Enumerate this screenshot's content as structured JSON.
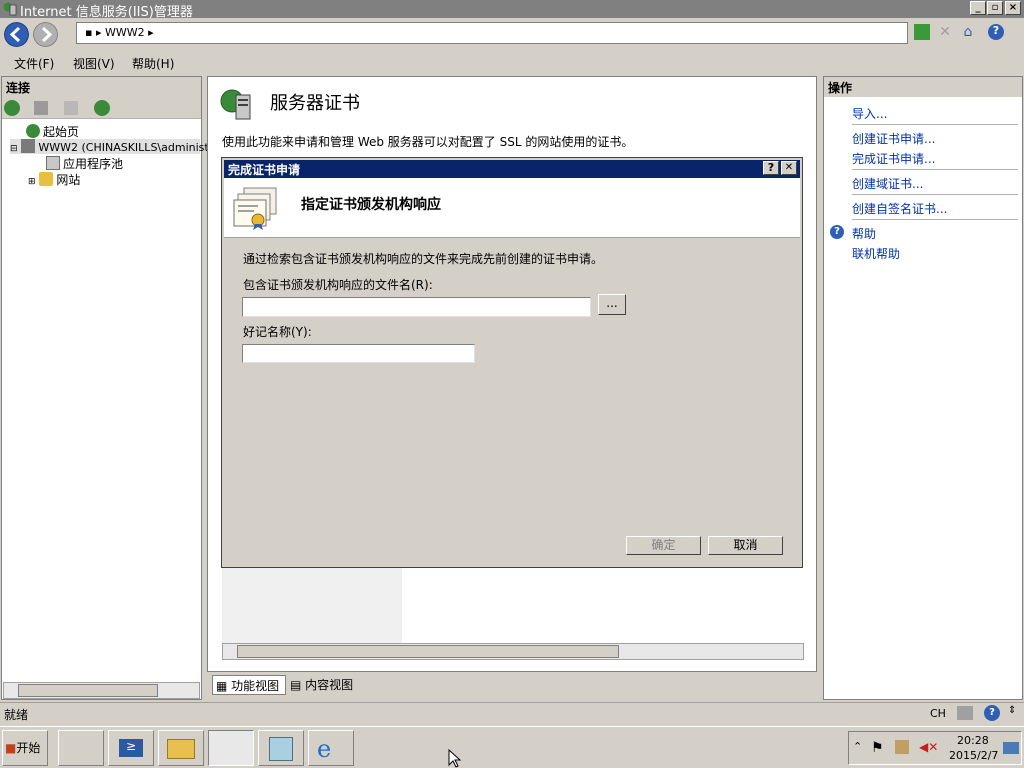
{
  "window": {
    "title": "Internet 信息服务(IIS)管理器",
    "address_path": "WWW2"
  },
  "menu": [
    "文件(F)",
    "视图(V)",
    "帮助(H)"
  ],
  "left_panel": {
    "header": "连接",
    "tree": [
      "起始页",
      "WWW2 (CHINASKILLS\\administ",
      "应用程序池",
      "网站"
    ]
  },
  "center": {
    "title": "服务器证书",
    "description": "使用此功能来申请和管理 Web 服务器可以对配置了 SSL 的网站使用的证书。"
  },
  "dialog": {
    "title": "完成证书申请",
    "help_glyph": "?",
    "close_glyph": "✕",
    "heading": "指定证书颁发机构响应",
    "instruction": "通过检索包含证书颁发机构响应的文件来完成先前创建的证书申请。",
    "file_label": "包含证书颁发机构响应的文件名(R):",
    "file_value": "",
    "browse_label": "...",
    "friendly_label": "好记名称(Y):",
    "friendly_value": "",
    "ok_label": "确定",
    "cancel_label": "取消"
  },
  "right_panel": {
    "header": "操作",
    "actions": [
      "导入...",
      "创建证书申请...",
      "完成证书申请...",
      "创建域证书...",
      "创建自签名证书...",
      "帮助",
      "联机帮助"
    ]
  },
  "view_tabs": [
    "功能视图",
    "内容视图"
  ],
  "status": {
    "text": "就绪",
    "lang": "CH"
  },
  "taskbar": {
    "start_label": "开始",
    "time": "20:28",
    "date": "2015/2/7"
  },
  "colors": {
    "dialog_title": "#0a246a",
    "link": "#0033aa"
  }
}
